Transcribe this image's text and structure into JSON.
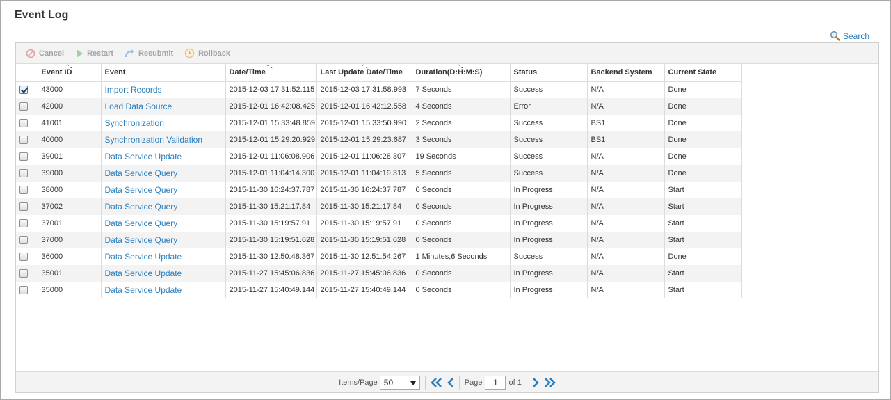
{
  "page": {
    "title": "Event Log",
    "search_label": "Search"
  },
  "toolbar": {
    "cancel": "Cancel",
    "restart": "Restart",
    "resubmit": "Resubmit",
    "rollback": "Rollback"
  },
  "table": {
    "headers": {
      "event_id": "Event ID",
      "event": "Event",
      "date_time": "Date/Time",
      "last_update": "Last Update Date/Time",
      "duration": "Duration(D:H:M:S)",
      "status": "Status",
      "backend": "Backend System",
      "state": "Current State"
    },
    "rows": [
      {
        "checked": true,
        "id": "43000",
        "event": "Import Records",
        "date": "2015-12-03 17:31:52.115",
        "last": "2015-12-03 17:31:58.993",
        "duration": "7 Seconds",
        "status": "Success",
        "backend": "N/A",
        "state": "Done"
      },
      {
        "checked": false,
        "id": "42000",
        "event": "Load Data Source",
        "date": "2015-12-01 16:42:08.425",
        "last": "2015-12-01 16:42:12.558",
        "duration": "4 Seconds",
        "status": "Error",
        "backend": "N/A",
        "state": "Done"
      },
      {
        "checked": false,
        "id": "41001",
        "event": "Synchronization",
        "date": "2015-12-01 15:33:48.859",
        "last": "2015-12-01 15:33:50.990",
        "duration": "2 Seconds",
        "status": "Success",
        "backend": "BS1",
        "state": "Done"
      },
      {
        "checked": false,
        "id": "40000",
        "event": "Synchronization Validation",
        "date": "2015-12-01 15:29:20.929",
        "last": "2015-12-01 15:29:23.687",
        "duration": "3 Seconds",
        "status": "Success",
        "backend": "BS1",
        "state": "Done"
      },
      {
        "checked": false,
        "id": "39001",
        "event": "Data Service Update",
        "date": "2015-12-01 11:06:08.906",
        "last": "2015-12-01 11:06:28.307",
        "duration": "19 Seconds",
        "status": "Success",
        "backend": "N/A",
        "state": "Done"
      },
      {
        "checked": false,
        "id": "39000",
        "event": "Data Service Query",
        "date": "2015-12-01 11:04:14.300",
        "last": "2015-12-01 11:04:19.313",
        "duration": "5 Seconds",
        "status": "Success",
        "backend": "N/A",
        "state": "Done"
      },
      {
        "checked": false,
        "id": "38000",
        "event": "Data Service Query",
        "date": "2015-11-30 16:24:37.787",
        "last": "2015-11-30 16:24:37.787",
        "duration": "0 Seconds",
        "status": "In Progress",
        "backend": "N/A",
        "state": "Start"
      },
      {
        "checked": false,
        "id": "37002",
        "event": "Data Service Query",
        "date": "2015-11-30 15:21:17.84",
        "last": "2015-11-30 15:21:17.84",
        "duration": "0 Seconds",
        "status": "In Progress",
        "backend": "N/A",
        "state": "Start"
      },
      {
        "checked": false,
        "id": "37001",
        "event": "Data Service Query",
        "date": "2015-11-30 15:19:57.91",
        "last": "2015-11-30 15:19:57.91",
        "duration": "0 Seconds",
        "status": "In Progress",
        "backend": "N/A",
        "state": "Start"
      },
      {
        "checked": false,
        "id": "37000",
        "event": "Data Service Query",
        "date": "2015-11-30 15:19:51.628",
        "last": "2015-11-30 15:19:51.628",
        "duration": "0 Seconds",
        "status": "In Progress",
        "backend": "N/A",
        "state": "Start"
      },
      {
        "checked": false,
        "id": "36000",
        "event": "Data Service Update",
        "date": "2015-11-30 12:50:48.367",
        "last": "2015-11-30 12:51:54.267",
        "duration": "1 Minutes,6 Seconds",
        "status": "Success",
        "backend": "N/A",
        "state": "Done"
      },
      {
        "checked": false,
        "id": "35001",
        "event": "Data Service Update",
        "date": "2015-11-27 15:45:06.836",
        "last": "2015-11-27 15:45:06.836",
        "duration": "0 Seconds",
        "status": "In Progress",
        "backend": "N/A",
        "state": "Start"
      },
      {
        "checked": false,
        "id": "35000",
        "event": "Data Service Update",
        "date": "2015-11-27 15:40:49.144",
        "last": "2015-11-27 15:40:49.144",
        "duration": "0 Seconds",
        "status": "In Progress",
        "backend": "N/A",
        "state": "Start"
      }
    ]
  },
  "pager": {
    "items_label": "Items/Page",
    "items_value": "50",
    "page_label": "Page",
    "page_value": "1",
    "of_label": "of 1"
  },
  "colors": {
    "link": "#2a7fbf",
    "toolbar_bg": "#f3f3f3",
    "alt_row": "#f3f3f3"
  }
}
